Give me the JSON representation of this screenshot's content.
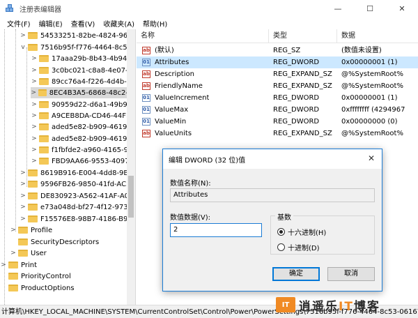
{
  "window": {
    "title": "注册表编辑器",
    "minimize": "—",
    "maximize": "☐",
    "close": "✕"
  },
  "menu": [
    "文件(F)",
    "编辑(E)",
    "查看(V)",
    "收藏夹(A)",
    "帮助(H)"
  ],
  "tree": {
    "items": [
      {
        "label": "54533251-82be-4824-96c",
        "expand": ">"
      },
      {
        "label": "7516b95f-f776-4464-8c5",
        "expand": "v"
      },
      {
        "label": "17aaa29b-8b43-4b94",
        "expand": ">"
      },
      {
        "label": "3c0bc021-c8a8-4e07-a",
        "expand": ">"
      },
      {
        "label": "89cc76a4-f226-4d4b-a",
        "expand": ">"
      },
      {
        "label": "8EC4B3A5-6868-48c2-",
        "expand": ">",
        "selected": true
      },
      {
        "label": "90959d22-d6a1-49b9",
        "expand": ">"
      },
      {
        "label": "A9CEB8DA-CD46-44FE",
        "expand": ">"
      },
      {
        "label": "aded5e82-b909-4619",
        "expand": ">"
      },
      {
        "label": "aded5e82-b909-4619",
        "expand": ">"
      },
      {
        "label": "f1fbfde2-a960-4165-9",
        "expand": ">"
      },
      {
        "label": "FBD9AA66-9553-4097",
        "expand": ">"
      },
      {
        "label": "8619B916-E004-4dd8-9B",
        "expand": ">"
      },
      {
        "label": "9596FB26-9850-41fd-AC3",
        "expand": ">"
      },
      {
        "label": "DE830923-A562-41AF-A0",
        "expand": ">"
      },
      {
        "label": "e73a048d-bf27-4f12-973",
        "expand": ">"
      },
      {
        "label": "F15576E8-98B7-4186-B94",
        "expand": ">"
      },
      {
        "label": "Profile",
        "expand": ">"
      },
      {
        "label": "SecurityDescriptors",
        "expand": ""
      },
      {
        "label": "User",
        "expand": ">"
      },
      {
        "label": "Print",
        "expand": ">"
      },
      {
        "label": "PriorityControl",
        "expand": ""
      },
      {
        "label": "ProductOptions",
        "expand": ""
      }
    ]
  },
  "list": {
    "columns": [
      "名称",
      "类型",
      "数据"
    ],
    "rows": [
      {
        "icon": "ab",
        "name": "(默认)",
        "type": "REG_SZ",
        "data": "(数值未设置)"
      },
      {
        "icon": "bin",
        "name": "Attributes",
        "type": "REG_DWORD",
        "data": "0x00000001 (1)",
        "selected": true
      },
      {
        "icon": "ab",
        "name": "Description",
        "type": "REG_EXPAND_SZ",
        "data": "@%SystemRoot%"
      },
      {
        "icon": "ab",
        "name": "FriendlyName",
        "type": "REG_EXPAND_SZ",
        "data": "@%SystemRoot%"
      },
      {
        "icon": "bin",
        "name": "ValueIncrement",
        "type": "REG_DWORD",
        "data": "0x00000001 (1)"
      },
      {
        "icon": "bin",
        "name": "ValueMax",
        "type": "REG_DWORD",
        "data": "0xffffffff (4294967"
      },
      {
        "icon": "bin",
        "name": "ValueMin",
        "type": "REG_DWORD",
        "data": "0x00000000 (0)"
      },
      {
        "icon": "ab",
        "name": "ValueUnits",
        "type": "REG_EXPAND_SZ",
        "data": "@%SystemRoot%"
      }
    ]
  },
  "statusbar": "计算机\\HKEY_LOCAL_MACHINE\\SYSTEM\\CurrentControlSet\\Control\\Power\\PowerSettings\\7516b95f-f776-4464-8c53-06167f",
  "dialog": {
    "title": "编辑 DWORD (32 位)值",
    "close": "✕",
    "name_label": "数值名称(N):",
    "name_value": "Attributes",
    "data_label": "数值数据(V):",
    "data_value": "2",
    "base_label": "基数",
    "hex_label": "十六进制(H)",
    "dec_label": "十进制(D)",
    "ok": "确定",
    "cancel": "取消"
  },
  "watermark": {
    "logo": "IT",
    "text": "逍遥乐",
    "text_it": "IT",
    "text_tail": "博客"
  }
}
